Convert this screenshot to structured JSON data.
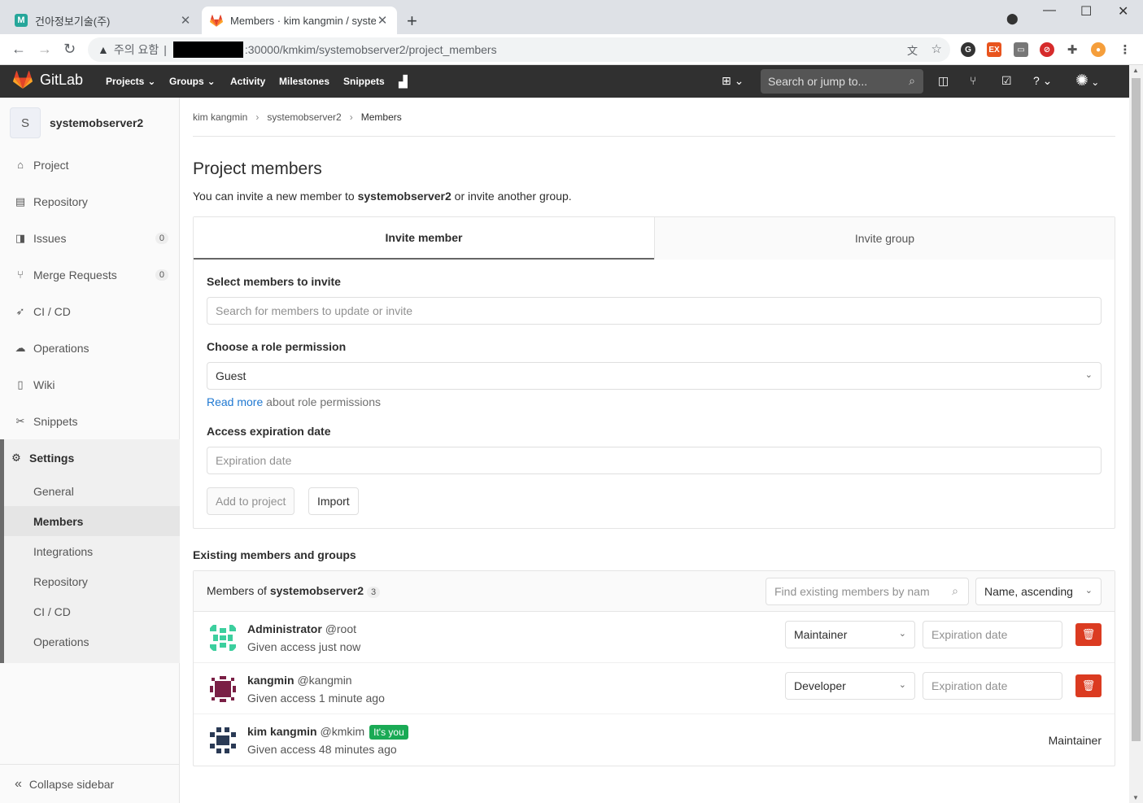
{
  "browser": {
    "tabs": [
      {
        "title": "건아정보기술(주)",
        "favicon": "M"
      },
      {
        "title": "Members · kim kangmin / syste",
        "favicon": "gitlab-fox"
      }
    ],
    "address": {
      "warning": "주의 요함",
      "url": ":30000/kmkim/systemobserver2/project_members"
    }
  },
  "gitlab": {
    "brand": "GitLab",
    "menu": [
      "Projects",
      "Groups",
      "Activity",
      "Milestones",
      "Snippets"
    ],
    "search_placeholder": "Search or jump to..."
  },
  "sidebar": {
    "project_initial": "S",
    "project_name": "systemobserver2",
    "items": [
      {
        "label": "Project",
        "icon": "home-icon"
      },
      {
        "label": "Repository",
        "icon": "document-icon"
      },
      {
        "label": "Issues",
        "icon": "issues-icon",
        "badge": "0"
      },
      {
        "label": "Merge Requests",
        "icon": "merge-request-icon",
        "badge": "0"
      },
      {
        "label": "CI / CD",
        "icon": "rocket-icon"
      },
      {
        "label": "Operations",
        "icon": "cloud-gear-icon"
      },
      {
        "label": "Wiki",
        "icon": "book-icon"
      },
      {
        "label": "Snippets",
        "icon": "scissors-icon"
      },
      {
        "label": "Settings",
        "icon": "gear-icon"
      }
    ],
    "settings_sub": [
      "General",
      "Members",
      "Integrations",
      "Repository",
      "CI / CD",
      "Operations"
    ],
    "collapse": "Collapse sidebar"
  },
  "breadcrumb": [
    "kim kangmin",
    "systemobserver2",
    "Members"
  ],
  "page": {
    "title": "Project members",
    "lead_prefix": "You can invite a new member to ",
    "lead_project": "systemobserver2",
    "lead_suffix": " or invite another group."
  },
  "invite": {
    "tabs": [
      "Invite member",
      "Invite group"
    ],
    "select_label": "Select members to invite",
    "search_placeholder": "Search for members to update or invite",
    "role_label": "Choose a role permission",
    "role_value": "Guest",
    "read_more": "Read more",
    "read_more_suffix": " about role permissions",
    "expiry_label": "Access expiration date",
    "expiry_placeholder": "Expiration date",
    "add_button": "Add to project",
    "import_button": "Import"
  },
  "existing": {
    "title": "Existing members and groups",
    "members_of": "Members of ",
    "project": "systemobserver2",
    "count": "3",
    "search_placeholder": "Find existing members by nam",
    "sort": "Name, ascending",
    "members": [
      {
        "name": "Administrator",
        "username": "@root",
        "access": "Given access just now",
        "role": "Maintainer",
        "expiry": "Expiration date",
        "color": "#3ccf9e"
      },
      {
        "name": "kangmin",
        "username": "@kangmin",
        "access": "Given access 1 minute ago",
        "role": "Developer",
        "expiry": "Expiration date",
        "color": "#7a1f45"
      },
      {
        "name": "kim kangmin",
        "username": "@kmkim",
        "access": "Given access 48 minutes ago",
        "role": "Maintainer",
        "badge": "It's you",
        "color": "#2a3a55"
      }
    ]
  }
}
